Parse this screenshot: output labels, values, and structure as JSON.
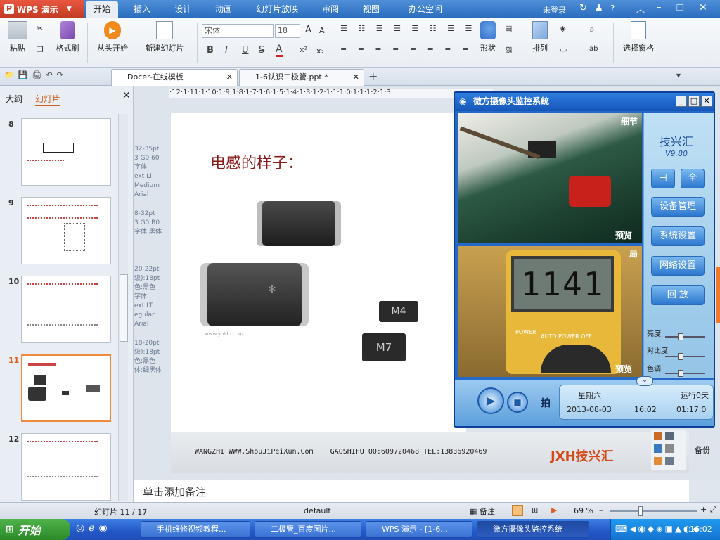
{
  "app": {
    "wps_button": "WPS 演示"
  },
  "ribbon_tabs": [
    "开始",
    "插入",
    "设计",
    "动画",
    "幻灯片放映",
    "审阅",
    "视图",
    "办公空间"
  ],
  "titlebar": {
    "login": "未登录",
    "help": "?"
  },
  "ribbon": {
    "paste": "粘贴",
    "format_painter": "格式刷",
    "from_start": "从头开始",
    "new_slide": "新建幻灯片",
    "font_name": "宋体",
    "font_size": "18",
    "shape": "形状",
    "arrange": "排列",
    "select_pane": "选择窗格",
    "bold": "B",
    "italic": "I",
    "underline": "U",
    "strike": "S"
  },
  "doc_tabs": [
    {
      "label": "Docer-在线模板"
    },
    {
      "label": "1-6认识二极管.ppt *"
    }
  ],
  "left_pane": {
    "tab_outline": "大纲",
    "tab_slides": "幻灯片",
    "thumbnails": [
      {
        "num": "8"
      },
      {
        "num": "9"
      },
      {
        "num": "10"
      },
      {
        "num": "11"
      },
      {
        "num": "12"
      }
    ],
    "current_slide": "11"
  },
  "ruler": "·12·1·11·1·10·1·9·1·8·1·7·1·6·1·5·1·4·1·3·1·2·1·1·1·0·1·1·1·2·1·3·",
  "behind_text": [
    "32-35pt",
    "3 G0 60",
    "字体",
    "ext LI",
    "Medium",
    "Arial",
    "8-32pt",
    "3 G0 B0",
    "字体:黑体",
    "20-22pt",
    "级):18pt",
    "色:黑色",
    "字体",
    "ext LT",
    "egular",
    "Arial",
    "18-20pt",
    "级):18pt",
    "色:黑色",
    "体:细黑体"
  ],
  "slide": {
    "title": "电感的样子：",
    "footer": "WANGZHI WWW.ShouJiPeiXun.Com    GAOSHIFU QQ:609720468 TEL:13836920469",
    "logo": "JXH技兴汇",
    "small_credit": "www.yoldo.com",
    "chip_labels": [
      "M4",
      "M7"
    ]
  },
  "notes_placeholder": "单击添加备注",
  "status": {
    "slide_counter": "幻灯片 11 / 17",
    "template": "default",
    "notes": "备注",
    "zoom": "69 %",
    "backup": "备份"
  },
  "camera_window": {
    "title": "微方摄像头监控系统",
    "label_detail": "细节",
    "label_preview_top": "预览",
    "label_preview_bottom": "预览",
    "label_partial": "局",
    "meter_reading": "1141",
    "meter_brand": "AUTO POWER OFF",
    "meter_power": "POWER",
    "brand": "技兴汇",
    "version": "V9.80",
    "btn_pin": "⊣",
    "btn_full": "全",
    "buttons": [
      "设备管理",
      "系统设置",
      "网络设置",
      "回 放"
    ],
    "sliders": [
      "亮度",
      "对比度",
      "色调"
    ],
    "snapshot": "拍",
    "weekday": "星期六",
    "date": "2013-08-03",
    "time": "16:02",
    "runtime_label": "运行0天",
    "runtime": "01:17:0"
  },
  "taskbar": {
    "start": "开始",
    "items": [
      "手机维修视频教程...",
      "二极管_百度图片...",
      "WPS 演示 - [1-6...",
      "微方摄像头监控系统"
    ],
    "clock": "16:02"
  },
  "colors": {
    "title_blue": "#2a6dbf",
    "wps_red": "#c23a22",
    "slide_title": "#8b1a1a",
    "taskbar": "#2457c7"
  }
}
